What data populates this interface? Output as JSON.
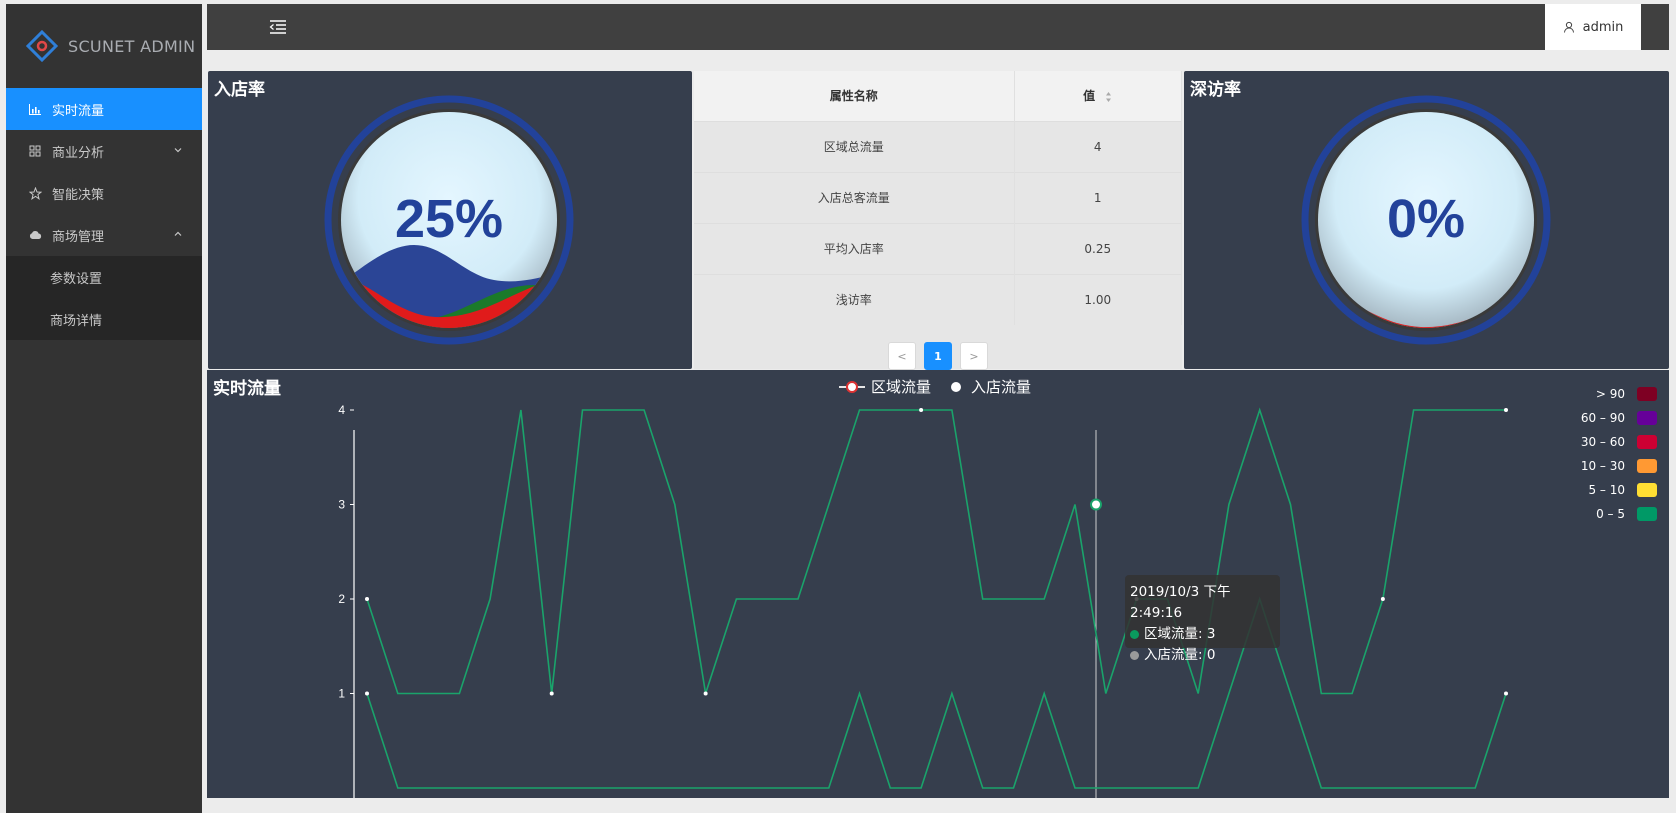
{
  "brand": {
    "name": "SCUNET ADMIN"
  },
  "sidebar": {
    "items": [
      {
        "label": "实时流量",
        "icon": "bar-chart-icon",
        "active": true
      },
      {
        "label": "商业分析",
        "icon": "shop-icon",
        "expanded": false
      },
      {
        "label": "智能决策",
        "icon": "star-icon"
      },
      {
        "label": "商场管理",
        "icon": "cloud-icon",
        "expanded": true
      }
    ],
    "subitems": [
      {
        "label": "参数设置"
      },
      {
        "label": "商场详情"
      }
    ]
  },
  "header": {
    "user": "admin"
  },
  "gauges": [
    {
      "title": "入店率",
      "value": "25%",
      "level": 0.25
    },
    {
      "title": "深访率",
      "value": "0%",
      "level": 0
    }
  ],
  "table": {
    "headers": [
      "属性名称",
      "值"
    ],
    "rows": [
      [
        "区域总流量",
        "4"
      ],
      [
        "入店总客流量",
        "1"
      ],
      [
        "平均入店率",
        "0.25"
      ],
      [
        "浅访率",
        "1.00"
      ]
    ],
    "pagination": {
      "prev": "<",
      "current": "1",
      "next": ">"
    }
  },
  "chart_data": {
    "type": "line",
    "title": "实时流量",
    "legend": [
      "区域流量",
      "入店流量"
    ],
    "yticks": [
      "1",
      "2",
      "3",
      "4"
    ],
    "ylim": [
      0,
      4
    ],
    "series": [
      {
        "name": "区域流量",
        "values": [
          2,
          1,
          1,
          1,
          2,
          4,
          1,
          4,
          4,
          4,
          3,
          1,
          2,
          2,
          2,
          3,
          4,
          4,
          4,
          4,
          2,
          2,
          2,
          3,
          1,
          2,
          2,
          1,
          3,
          4,
          3,
          1,
          1,
          2,
          4,
          4,
          4,
          4
        ]
      },
      {
        "name": "入店流量",
        "values": [
          1,
          0,
          0,
          0,
          0,
          0,
          0,
          0,
          0,
          0,
          0,
          0,
          0,
          0,
          0,
          0,
          1,
          0,
          0,
          1,
          0,
          0,
          1,
          0,
          0,
          0,
          0,
          0,
          1,
          2,
          1,
          0,
          0,
          0,
          0,
          0,
          0,
          1
        ]
      }
    ],
    "visual_map": [
      {
        "label": "> 90",
        "color": "#7e0023"
      },
      {
        "label": "60 – 90",
        "color": "#660099"
      },
      {
        "label": "30 – 60",
        "color": "#cc0033"
      },
      {
        "label": "10 – 30",
        "color": "#ff9933"
      },
      {
        "label": "5 – 10",
        "color": "#ffde33"
      },
      {
        "label": "0 – 5",
        "color": "#096"
      }
    ],
    "line_color": "#1aa36b",
    "tooltip": {
      "time": "2019/10/3 下午2:49:16",
      "line1": "区域流量: 3",
      "line2": "入店流量: 0"
    }
  },
  "colors": {
    "accent": "#1890ff",
    "panel": "#363e4d",
    "gauge_ring": "#22429a",
    "gauge_text": "#22429a"
  }
}
